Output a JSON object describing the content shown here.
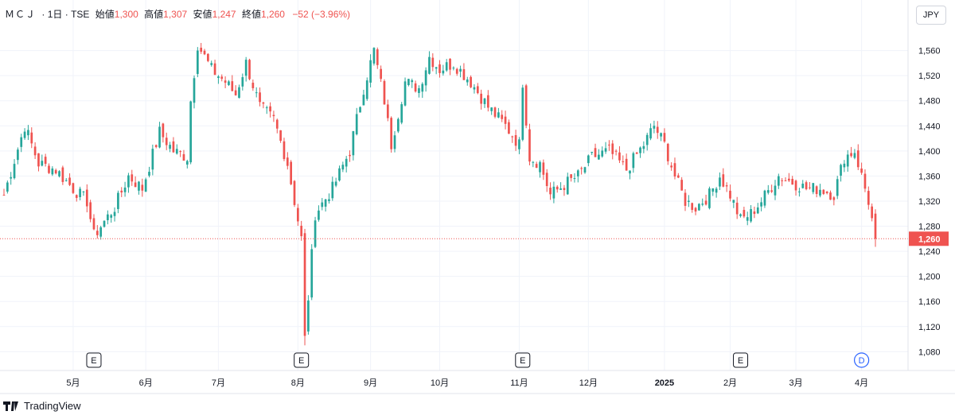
{
  "legend": {
    "symbol": "ＭＣＪ",
    "interval": "1日",
    "exchange": "TSE",
    "open_label": "始値",
    "open": "1,300",
    "high_label": "高値",
    "high": "1,307",
    "low_label": "安値",
    "low": "1,247",
    "close_label": "終値",
    "close": "1,260",
    "change": "−52 (−3.96%)"
  },
  "currency": "JPY",
  "brand": "TradingView",
  "colors": {
    "up": "#26a69a",
    "down": "#ef5350",
    "grid": "#f0f3fa",
    "axis": "#e0e3eb"
  },
  "chart_data": {
    "type": "candlestick",
    "ylim": [
      1050,
      1600
    ],
    "yticks": [
      1080,
      1120,
      1160,
      1200,
      1240,
      1280,
      1320,
      1360,
      1400,
      1440,
      1480,
      1520,
      1560
    ],
    "ytick_labels": [
      "1,080",
      "1,120",
      "1,160",
      "1,200",
      "1,240",
      "1,280",
      "1,320",
      "1,360",
      "1,400",
      "1,440",
      "1,480",
      "1,520",
      "1,560"
    ],
    "last_price": 1260,
    "last_price_label": "1,260",
    "x_labels": [
      {
        "i": 20,
        "label": "5月"
      },
      {
        "i": 41,
        "label": "6月"
      },
      {
        "i": 62,
        "label": "7月"
      },
      {
        "i": 85,
        "label": "8月"
      },
      {
        "i": 106,
        "label": "9月"
      },
      {
        "i": 126,
        "label": "10月"
      },
      {
        "i": 149,
        "label": "11月"
      },
      {
        "i": 169,
        "label": "12月"
      },
      {
        "i": 191,
        "label": "2025"
      },
      {
        "i": 210,
        "label": "2月"
      },
      {
        "i": 229,
        "label": "3月"
      },
      {
        "i": 248,
        "label": "4月"
      }
    ],
    "events": [
      {
        "i": 26,
        "label": "E"
      },
      {
        "i": 86,
        "label": "E"
      },
      {
        "i": 150,
        "label": "E"
      },
      {
        "i": 213,
        "label": "E"
      },
      {
        "i": 248,
        "label": "D"
      }
    ],
    "anchors": [
      [
        0,
        1330
      ],
      [
        6,
        1440
      ],
      [
        10,
        1380
      ],
      [
        15,
        1370
      ],
      [
        20,
        1340
      ],
      [
        24,
        1320
      ],
      [
        26,
        1265
      ],
      [
        32,
        1310
      ],
      [
        36,
        1360
      ],
      [
        40,
        1340
      ],
      [
        45,
        1430
      ],
      [
        49,
        1400
      ],
      [
        53,
        1390
      ],
      [
        54,
        1480
      ],
      [
        56,
        1570
      ],
      [
        60,
        1530
      ],
      [
        64,
        1510
      ],
      [
        67,
        1490
      ],
      [
        70,
        1540
      ],
      [
        74,
        1470
      ],
      [
        78,
        1450
      ],
      [
        82,
        1380
      ],
      [
        86,
        1260
      ],
      [
        87,
        1100
      ],
      [
        90,
        1300
      ],
      [
        95,
        1340
      ],
      [
        100,
        1400
      ],
      [
        104,
        1500
      ],
      [
        107,
        1560
      ],
      [
        110,
        1480
      ],
      [
        112,
        1410
      ],
      [
        116,
        1510
      ],
      [
        120,
        1500
      ],
      [
        123,
        1550
      ],
      [
        126,
        1530
      ],
      [
        130,
        1540
      ],
      [
        135,
        1510
      ],
      [
        140,
        1470
      ],
      [
        145,
        1440
      ],
      [
        149,
        1410
      ],
      [
        150,
        1510
      ],
      [
        152,
        1390
      ],
      [
        155,
        1380
      ],
      [
        158,
        1330
      ],
      [
        163,
        1350
      ],
      [
        166,
        1360
      ],
      [
        170,
        1390
      ],
      [
        175,
        1400
      ],
      [
        180,
        1370
      ],
      [
        185,
        1410
      ],
      [
        188,
        1440
      ],
      [
        191,
        1410
      ],
      [
        194,
        1360
      ],
      [
        197,
        1320
      ],
      [
        200,
        1310
      ],
      [
        204,
        1330
      ],
      [
        207,
        1360
      ],
      [
        210,
        1330
      ],
      [
        213,
        1290
      ],
      [
        216,
        1300
      ],
      [
        219,
        1320
      ],
      [
        224,
        1360
      ],
      [
        228,
        1350
      ],
      [
        232,
        1340
      ],
      [
        236,
        1340
      ],
      [
        240,
        1330
      ],
      [
        243,
        1390
      ],
      [
        246,
        1400
      ],
      [
        248,
        1360
      ],
      [
        250,
        1320
      ],
      [
        252,
        1260
      ]
    ]
  }
}
